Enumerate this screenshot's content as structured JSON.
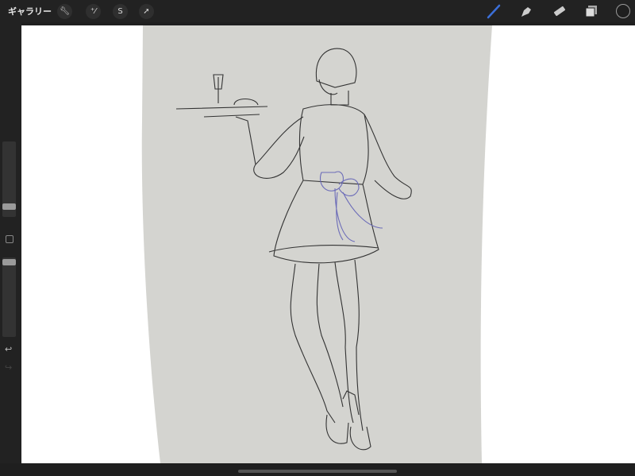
{
  "topbar": {
    "gallery_label": "ギャラリー",
    "left_tools": [
      "wrench-icon",
      "magic-wand-icon",
      "selection-icon",
      "transform-arrow-icon"
    ],
    "right_tools": [
      "brush-icon",
      "smudge-icon",
      "eraser-icon",
      "layers-icon",
      "color-icon"
    ]
  },
  "colors": {
    "accent": "#3b6fd8",
    "paper": "#d4d4d0",
    "sketch_blue": "#6b6bb8"
  }
}
